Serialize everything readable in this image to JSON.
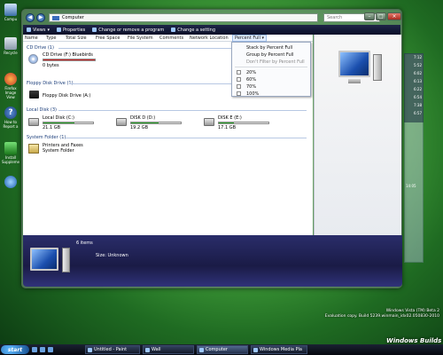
{
  "desktop": {
    "icons": [
      {
        "label": "Compu",
        "kind": "computer"
      },
      {
        "label": "Recycle",
        "kind": "recycle"
      },
      {
        "label": "Firefox Image View",
        "kind": "firefox"
      },
      {
        "label": "How to Report a",
        "kind": "help"
      },
      {
        "label": "Install Suppleme",
        "kind": "install"
      },
      {
        "label": "",
        "kind": "ie"
      }
    ],
    "clock_strip": [
      "7:12",
      "5:52",
      "6:02",
      "6:13",
      "6:22",
      "6:54",
      "7:38",
      "6:57"
    ],
    "side_time": "14:05",
    "watermark": {
      "line1": "Windows Vista (TM) Beta 2",
      "line2": "Evaluation copy. Build 5239.winmain_idx02.050830-2010"
    },
    "brand": "Windows Builds"
  },
  "window": {
    "address": "Computer",
    "search_placeholder": "Search",
    "toolbar": {
      "views": "Views",
      "properties": "Properties",
      "change_program": "Change or remove a program",
      "change_setting": "Change a setting"
    },
    "columns": [
      "Name",
      "Type",
      "Total Size",
      "Free Space",
      "File System",
      "Comments",
      "Network Location",
      "Percent Full"
    ],
    "groups": {
      "cd": {
        "header": "CD Drive (1)",
        "item_name": "CD Drive (F:) Bluebirds",
        "item_detail": "0 bytes",
        "percent": 100,
        "bar_color": "#d32424"
      },
      "floppy": {
        "header": "Floppy Disk Drive (1)",
        "item_name": "Floppy Disk Drive (A:)"
      },
      "local": {
        "header": "Local Disk (3)",
        "items": [
          {
            "name": "Local Disk (C:)",
            "detail": "21.1 GB",
            "percent": 62,
            "bar_color": "#2eaa2e"
          },
          {
            "name": "DISK D (D:)",
            "detail": "19.2 GB",
            "percent": 55,
            "bar_color": "#2eaa2e"
          },
          {
            "name": "DISK E (E:)",
            "detail": "17.1 GB",
            "percent": 30,
            "bar_color": "#2eaa2e"
          }
        ]
      },
      "system": {
        "header": "System Folder (1)",
        "item_name": "Printers and Faxes",
        "item_detail": "System Folder"
      }
    },
    "dropdown": {
      "stack": "Stack by Percent Full",
      "group": "Group by Percent Full",
      "filter": "Don't Filter by Percent Full",
      "options": [
        "20%",
        "60%",
        "70%",
        "100%"
      ]
    },
    "details": {
      "count": "6 items",
      "size_label": "Size:",
      "size_value": "Unknown"
    }
  },
  "taskbar": {
    "start": "start",
    "tasks": [
      {
        "label": "Untitled - Paint",
        "active": false
      },
      {
        "label": "Wall",
        "active": false
      },
      {
        "label": "Computer",
        "active": true
      },
      {
        "label": "Windows Media Pla",
        "active": false
      }
    ]
  }
}
